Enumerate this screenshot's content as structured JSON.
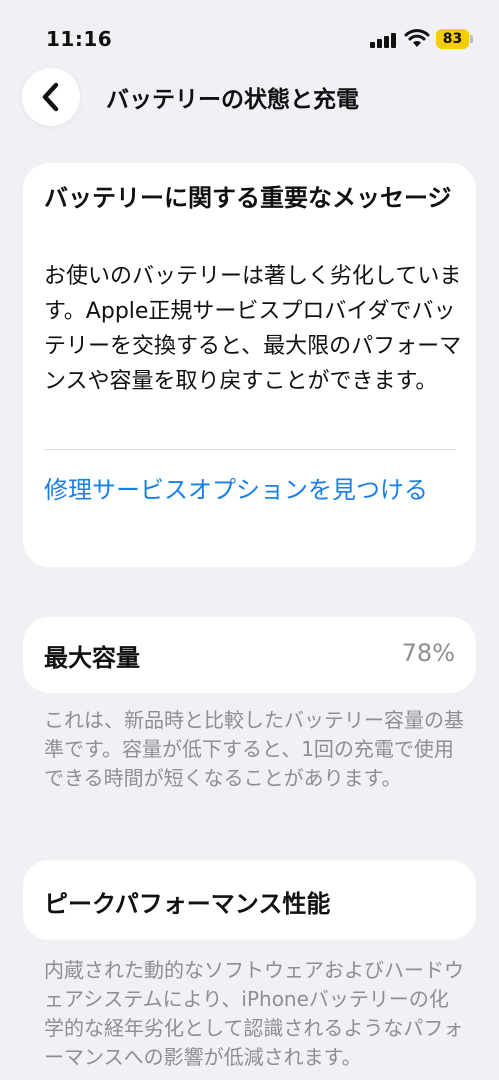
{
  "status_bar": {
    "time": "11:16",
    "battery_level": "83",
    "battery_color": "#f5cd00"
  },
  "nav": {
    "back_icon": "chevron-left-icon",
    "title": "バッテリーの状態と充電"
  },
  "important_message": {
    "title": "バッテリーに関する重要なメッセージ",
    "body": "お使いのバッテリーは著しく劣化しています。Apple正規サービスプロバイダでバッテリーを交換すると、最大限のパフォーマンスや容量を取り戻すことができます。",
    "link": "修理サービスオプションを見つける",
    "link_color": "#1a7fe8"
  },
  "maximum_capacity": {
    "label": "最大容量",
    "value": "78%",
    "description": "これは、新品時と比較したバッテリー容量の基準です。容量が低下すると、1回の充電で使用できる時間が短くなることがあります。"
  },
  "peak_performance": {
    "label": "ピークパフォーマンス性能",
    "description": "内蔵された動的なソフトウェアおよびハードウェアシステムにより、iPhoneバッテリーの化学的な経年劣化として認識されるようなパフォーマンスへの影響が低減されます。"
  }
}
